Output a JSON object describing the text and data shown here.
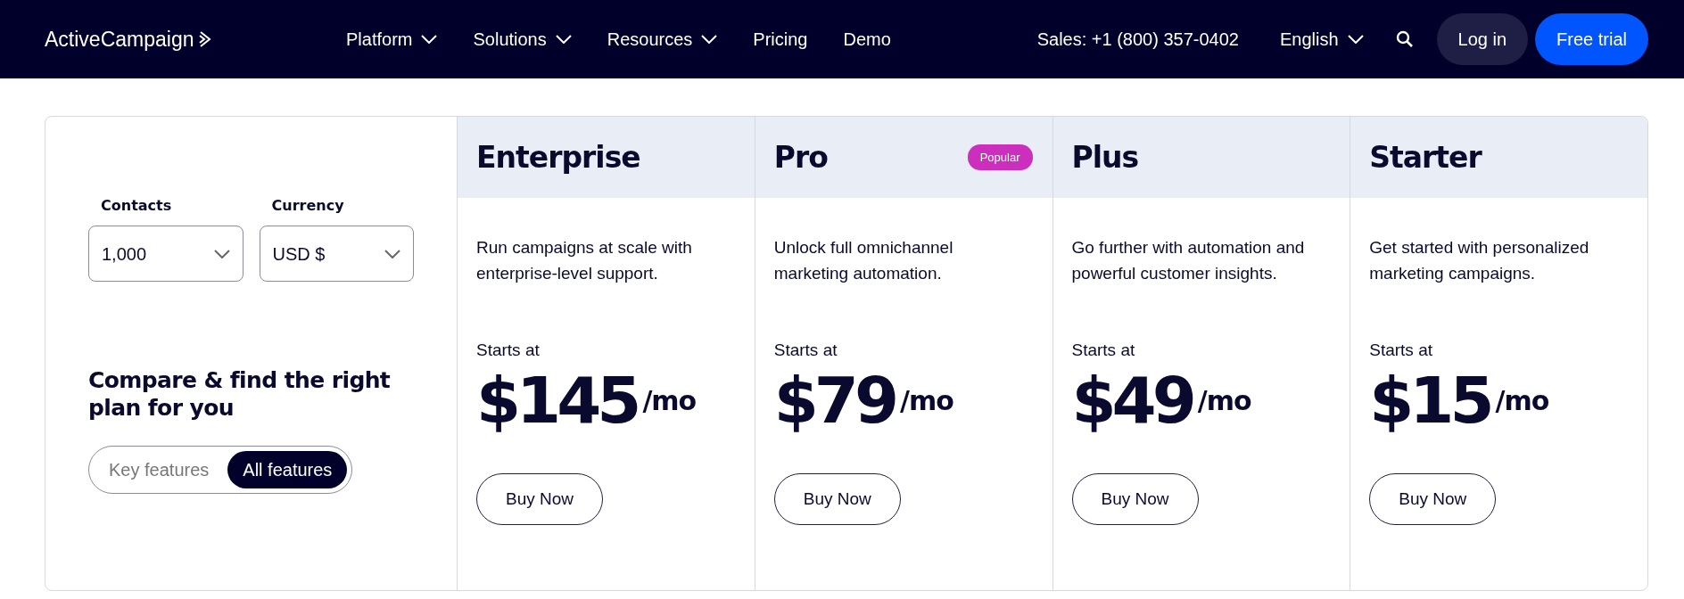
{
  "navbar": {
    "logo": "ActiveCampaign",
    "menu": [
      {
        "label": "Platform",
        "dropdown": true
      },
      {
        "label": "Solutions",
        "dropdown": true
      },
      {
        "label": "Resources",
        "dropdown": true
      },
      {
        "label": "Pricing",
        "dropdown": false
      },
      {
        "label": "Demo",
        "dropdown": false
      }
    ],
    "sales": "Sales: +1 (800) 357-0402",
    "language": "English",
    "login": "Log in",
    "trial": "Free trial"
  },
  "filters": [
    {
      "label": "Contacts",
      "value": "1,000"
    },
    {
      "label": "Currency",
      "value": "USD $"
    }
  ],
  "heading": "Compare & find the right plan for you",
  "toggle": [
    {
      "label": "Key features",
      "selected": false
    },
    {
      "label": "All features",
      "selected": true
    }
  ],
  "plans": [
    {
      "name": "Enterprise",
      "description": "Run campaigns at scale with enterprise-level support.",
      "starts": "Starts at",
      "price": "$145",
      "period": "/mo",
      "button": "Buy Now"
    },
    {
      "name": "Pro",
      "badge": "Popular",
      "description": "Unlock full omnichannel marketing automation.",
      "starts": "Starts at",
      "price": "$79",
      "period": "/mo",
      "button": "Buy Now"
    },
    {
      "name": "Plus",
      "description": "Go further with automation and powerful customer insights.",
      "starts": "Starts at",
      "price": "$49",
      "period": "/mo",
      "button": "Buy Now"
    },
    {
      "name": "Starter",
      "description": "Get started with personalized marketing campaigns.",
      "starts": "Starts at",
      "price": "$15",
      "period": "/mo",
      "button": "Buy Now"
    }
  ]
}
